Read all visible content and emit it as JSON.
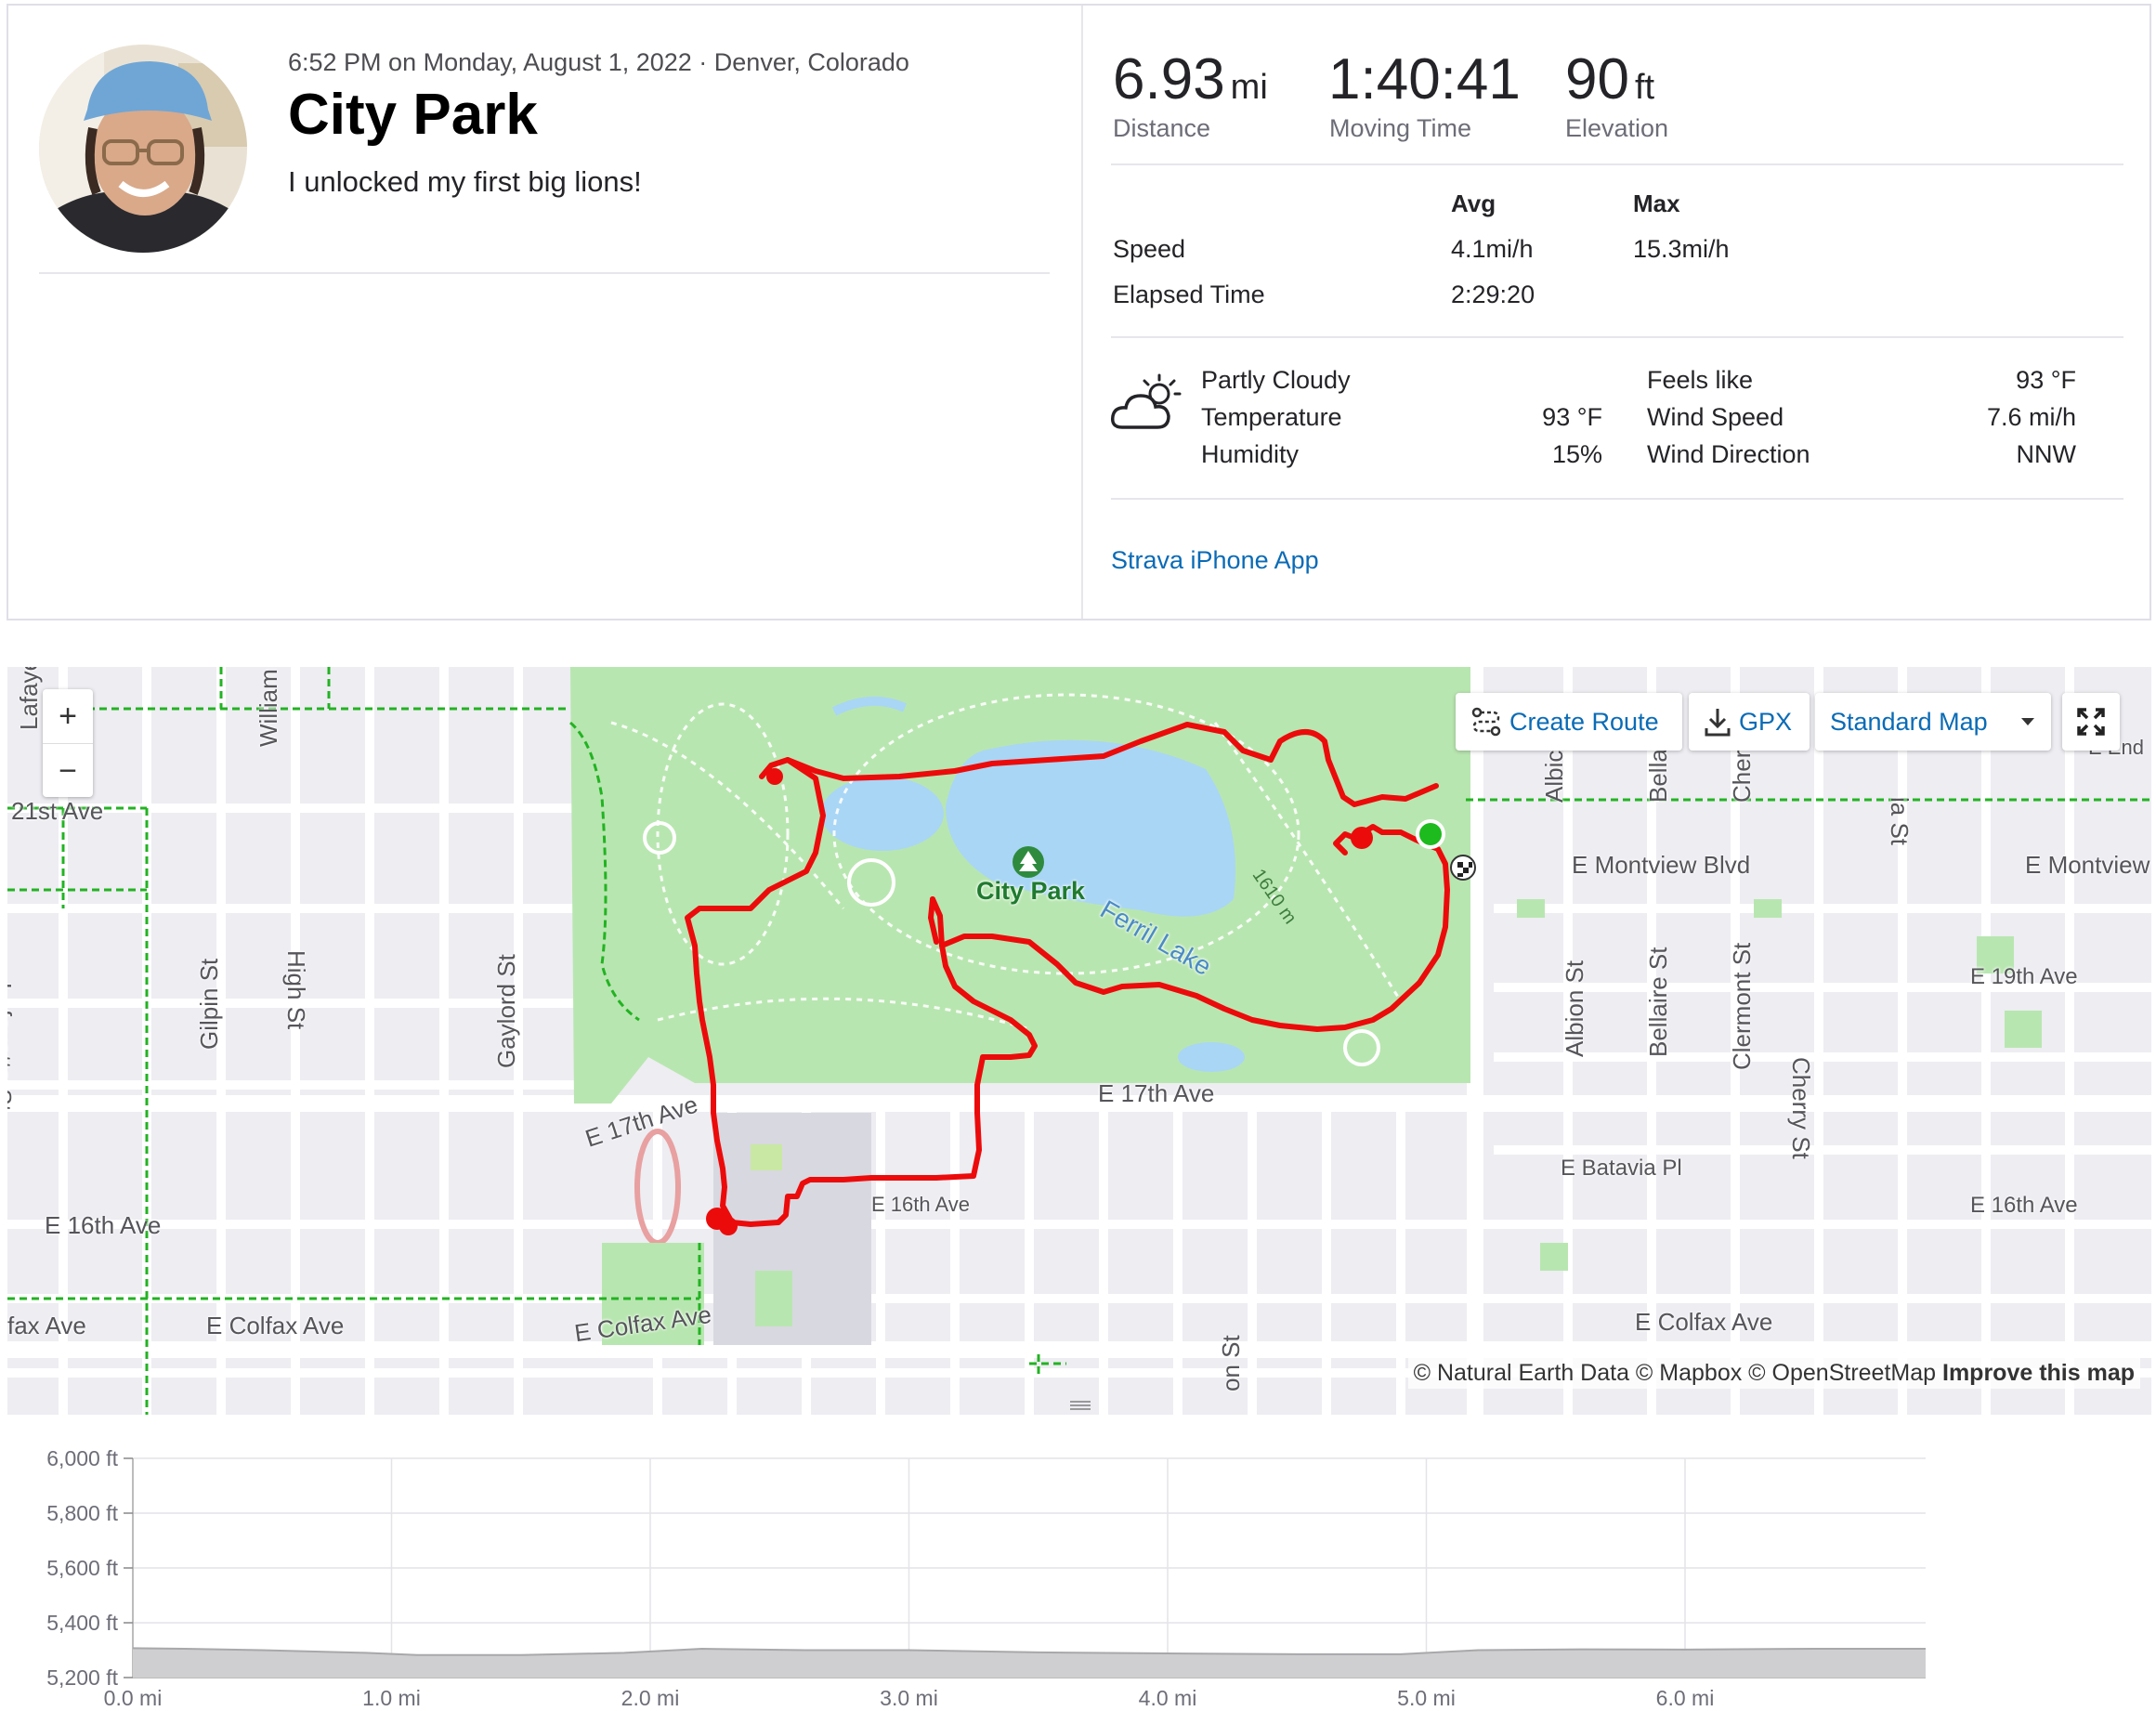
{
  "activity": {
    "meta_line": "6:52 PM on Monday, August 1, 2022 · Denver, Colorado",
    "title": "City Park",
    "description": "I unlocked my first big lions!"
  },
  "stats": {
    "distance": {
      "value": "6.93",
      "unit": "mi",
      "label": "Distance"
    },
    "moving_time": {
      "value": "1:40:41",
      "label": "Moving Time"
    },
    "elevation": {
      "value": "90",
      "unit": "ft",
      "label": "Elevation"
    }
  },
  "more_stats": {
    "headers": {
      "avg": "Avg",
      "max": "Max"
    },
    "speed": {
      "label": "Speed",
      "avg": "4.1mi/h",
      "max": "15.3mi/h"
    },
    "elapsed": {
      "label": "Elapsed Time",
      "avg": "2:29:20"
    }
  },
  "weather": {
    "icon": "partly-cloudy-icon",
    "condition": "Partly Cloudy",
    "temperature": {
      "label": "Temperature",
      "value": "93 °F"
    },
    "humidity": {
      "label": "Humidity",
      "value": "15%"
    },
    "feels_like": {
      "label": "Feels like",
      "value": "93 °F"
    },
    "wind_speed": {
      "label": "Wind Speed",
      "value": "7.6 mi/h"
    },
    "wind_direction": {
      "label": "Wind Direction",
      "value": "NNW"
    }
  },
  "device": "Strava iPhone App",
  "map": {
    "zoom_in": "+",
    "zoom_out": "−",
    "create_route": "Create Route",
    "gpx": "GPX",
    "map_style": "Standard Map",
    "attribution": "© Natural Earth Data © Mapbox © OpenStreetMap",
    "improve": "Improve this map",
    "park_label": "City Park",
    "lake_label": "Ferril Lake",
    "loop_label": "1610 m",
    "streets": {
      "lafayette_top": "Lafaye",
      "william": "William",
      "e21st": "21st Ave",
      "high": "High St",
      "gilpin": "Gilpin St",
      "gaylord": "Gaylord St",
      "lafayette": "Lafayette St",
      "e17th_left": "E 17th Ave",
      "e17th": "E 17th Ave",
      "e16th_left": "E 16th Ave",
      "e16th_mid": "E 16th Ave",
      "e16th_right": "E 16th Ave",
      "colfax_far": "fax Ave",
      "colfax_left": "E Colfax Ave",
      "colfax_mid": "E Colfax Ave",
      "colfax_right": "E Colfax Ave",
      "montview": "E Montview Blvd",
      "montview_right": "E Montview",
      "e19th": "E 19th Ave",
      "batavia": "E Batavia Pl",
      "albion": "Albion St",
      "albion_top": "Albic",
      "bellaire": "Bellaire St",
      "bellaire_top": "Bella",
      "clermont": "Clermont St",
      "cherry": "Cherry St",
      "cherry_top": "Cher",
      "dahlia_top": "ia St",
      "onst": "on St",
      "end": "E End"
    }
  },
  "elevation_chart": {
    "y_ticks": [
      "6,000 ft",
      "5,800 ft",
      "5,600 ft",
      "5,400 ft",
      "5,200 ft"
    ],
    "x_ticks": [
      "0.0 mi",
      "1.0 mi",
      "2.0 mi",
      "3.0 mi",
      "4.0 mi",
      "5.0 mi",
      "6.0 mi"
    ]
  },
  "chart_data": {
    "type": "area",
    "title": "",
    "xlabel": "",
    "ylabel": "",
    "ylim": [
      5200,
      6000
    ],
    "xlim": [
      0,
      6.93
    ],
    "x": [
      0.0,
      0.2,
      0.5,
      0.9,
      1.1,
      1.5,
      1.9,
      2.2,
      2.6,
      3.0,
      3.5,
      4.0,
      4.5,
      4.9,
      5.2,
      5.6,
      6.0,
      6.5,
      6.93
    ],
    "y": [
      5307,
      5305,
      5300,
      5290,
      5282,
      5282,
      5290,
      5305,
      5300,
      5300,
      5292,
      5288,
      5285,
      5285,
      5300,
      5303,
      5302,
      5305,
      5305
    ],
    "grid": true,
    "colors": {
      "fill": "#cfcfd2",
      "line": "#a8a8ab"
    }
  },
  "colors": {
    "route": "#ec0b0b",
    "park": "#b8e6b0",
    "water": "#a9d6f5",
    "link": "#0a6bb6",
    "bike_path": "#22b322",
    "start": "#1dbb1d"
  }
}
